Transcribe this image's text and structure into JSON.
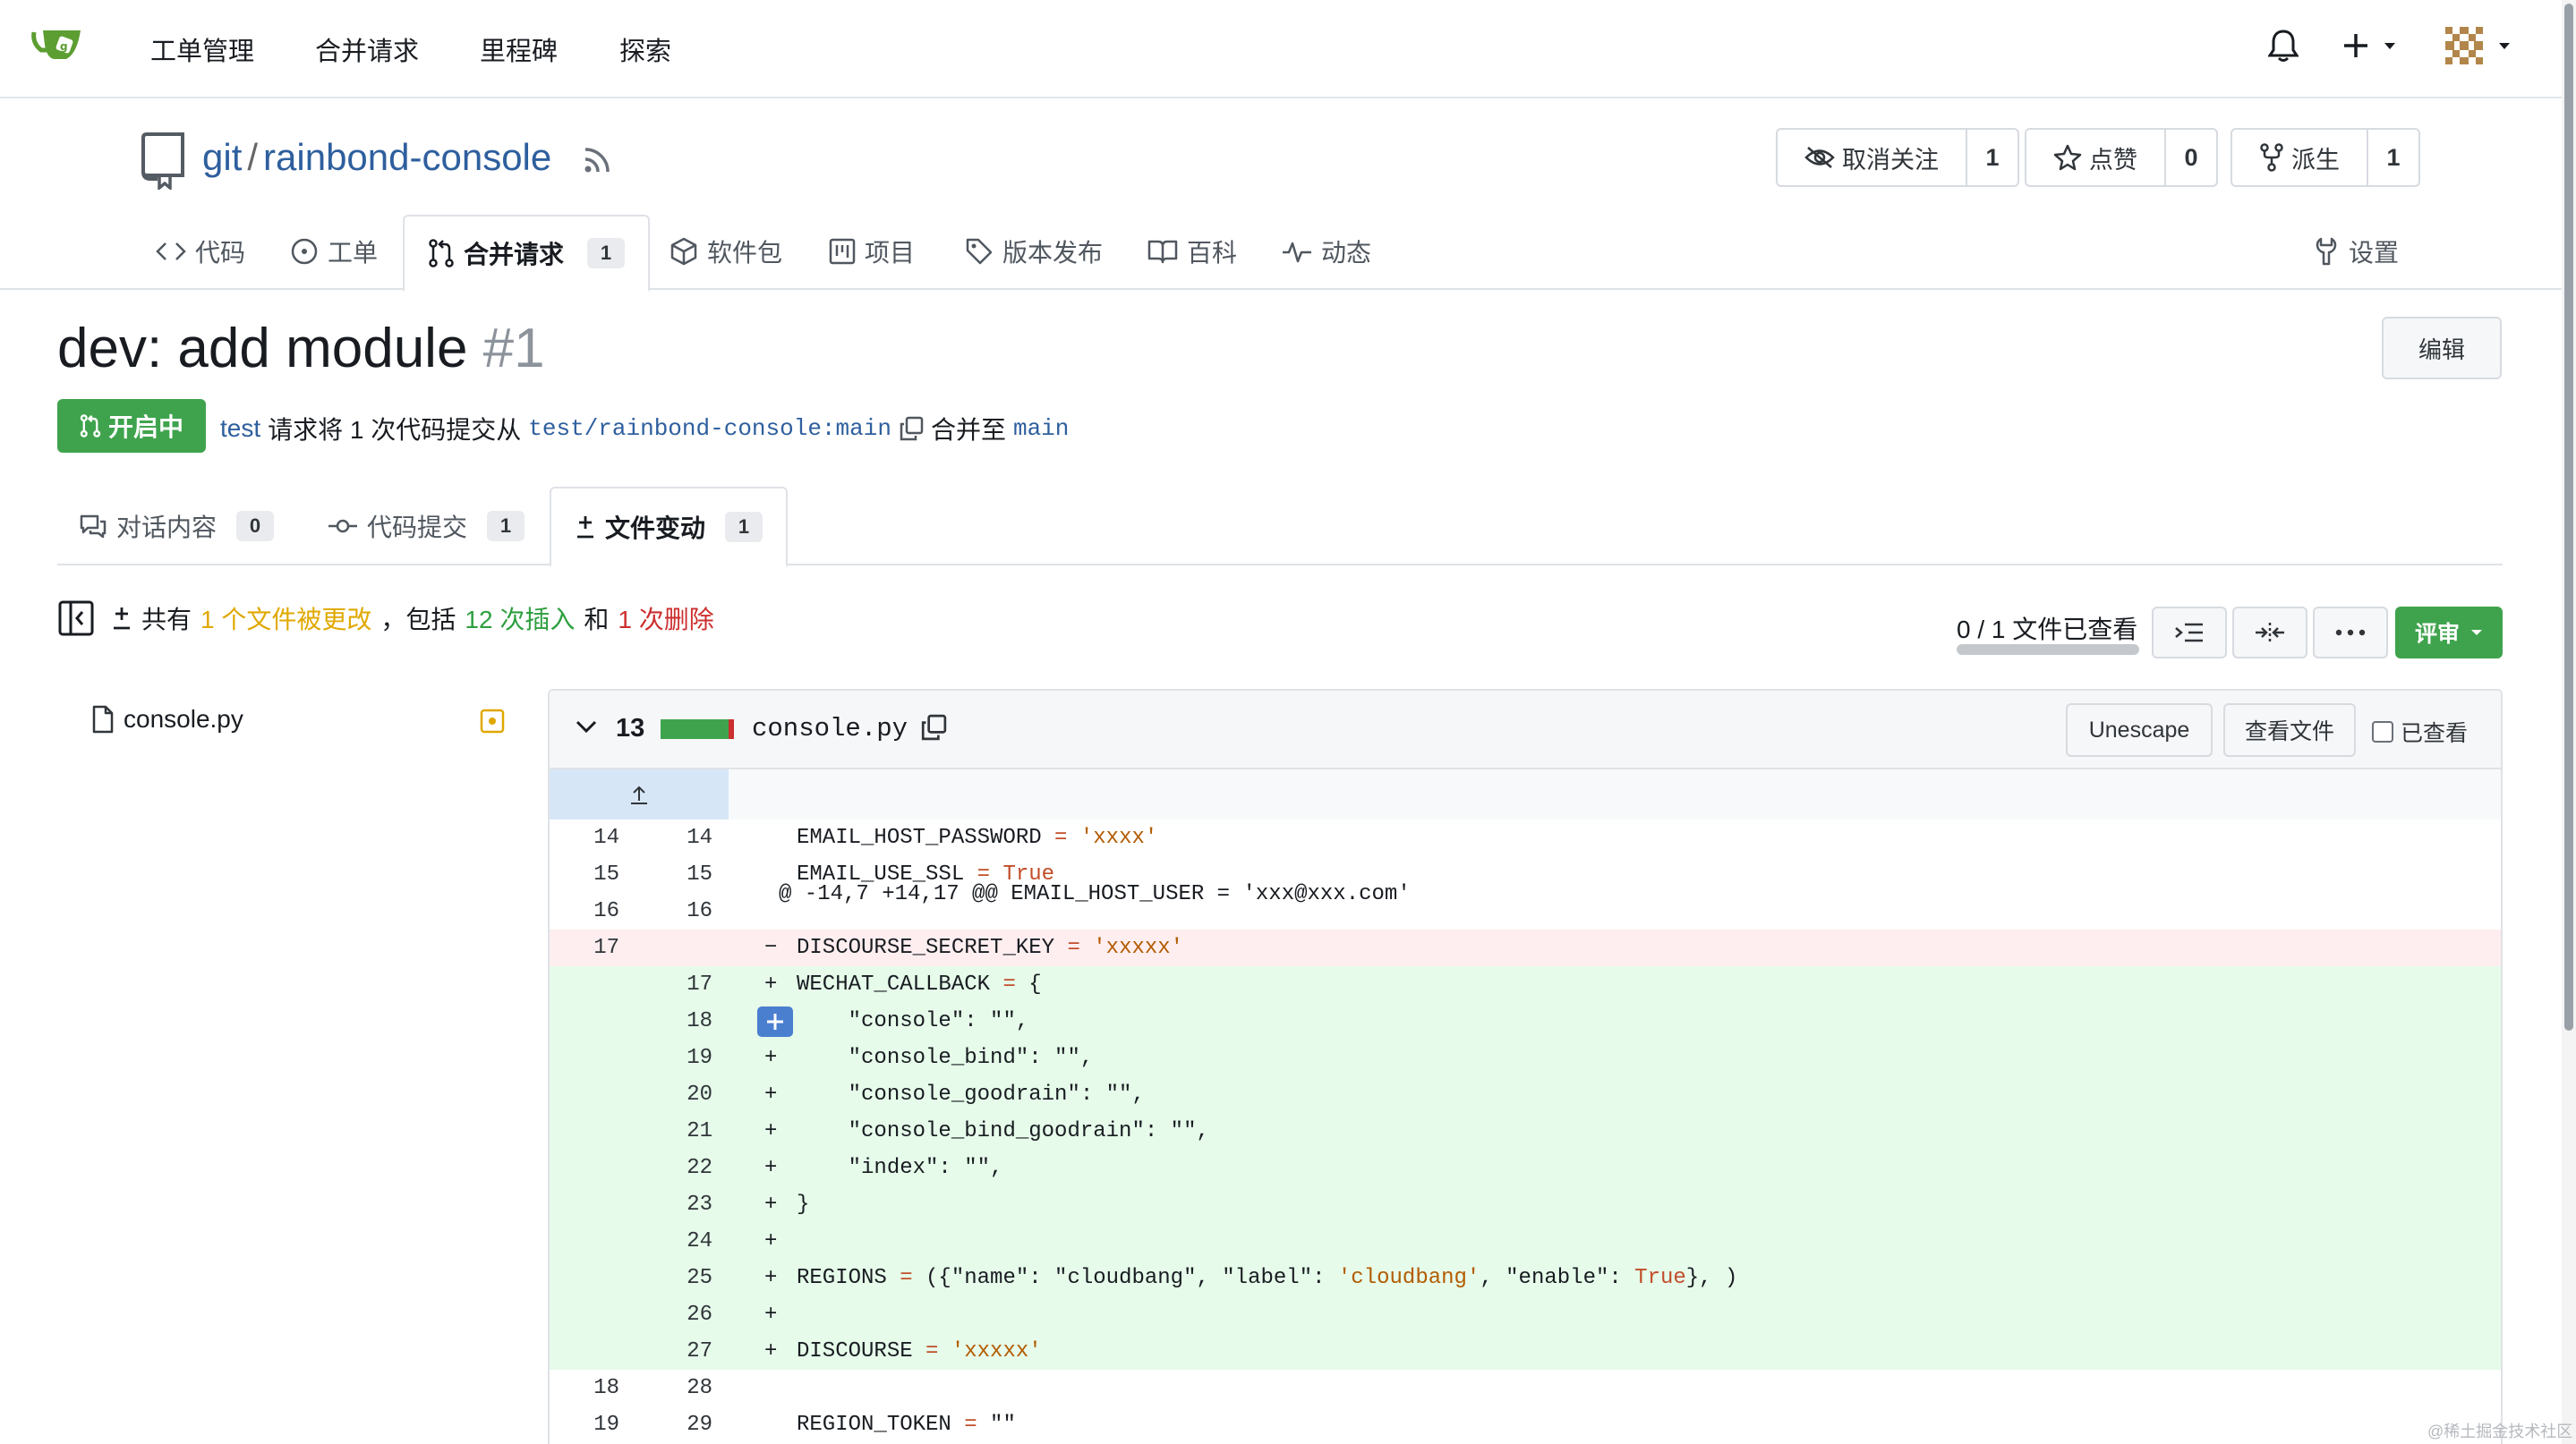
{
  "nav": {
    "items": [
      "工单管理",
      "合并请求",
      "里程碑",
      "探索"
    ]
  },
  "repo": {
    "owner": "git",
    "name": "rainbond-console",
    "unwatch_label": "取消关注",
    "watch_count": "1",
    "star_label": "点赞",
    "star_count": "0",
    "fork_label": "派生",
    "fork_count": "1",
    "tabs": {
      "code": "代码",
      "issues": "工单",
      "pulls": "合并请求",
      "pulls_count": "1",
      "packages": "软件包",
      "projects": "项目",
      "releases": "版本发布",
      "wiki": "百科",
      "activity": "动态",
      "settings": "设置"
    }
  },
  "pr": {
    "title": "dev: add module",
    "number": "#1",
    "edit_label": "编辑",
    "status": "开启中",
    "author": "test",
    "meta_text": "请求将 1 次代码提交从",
    "source_branch": "test/rainbond-console:main",
    "merge_into": "合并至",
    "target_branch": "main",
    "subtabs": {
      "conversation": "对话内容",
      "conversation_count": "0",
      "commits": "代码提交",
      "commits_count": "1",
      "files": "文件变动",
      "files_count": "1"
    }
  },
  "stats": {
    "prefix": "共有",
    "files_changed": "1 个文件被更改",
    "comma": "，包括",
    "additions": "12 次插入",
    "and": "和",
    "deletions": "1 次删除",
    "viewed": "0 / 1 文件已查看",
    "viewed_fraction": 0,
    "review_label": "评审"
  },
  "file_tree": {
    "file": "console.py"
  },
  "diff": {
    "file": "console.py",
    "changes": "13",
    "unescape_label": "Unescape",
    "view_file_label": "查看文件",
    "viewed_label": "已查看",
    "hunk_header": "@ -14,7 +14,17 @@ EMAIL_HOST_USER = 'xxx@xxx.com'",
    "lines": [
      {
        "type": "ctx",
        "old": "14",
        "new": "14",
        "mark": "",
        "code": [
          [
            "EMAIL_HOST_PASSWORD ",
            ""
          ],
          [
            "=",
            "kw"
          ],
          [
            " ",
            ""
          ],
          [
            "'xxxx'",
            "str"
          ]
        ]
      },
      {
        "type": "ctx",
        "old": "15",
        "new": "15",
        "mark": "",
        "code": [
          [
            "EMAIL_USE_SSL ",
            ""
          ],
          [
            "=",
            "kw"
          ],
          [
            " ",
            ""
          ],
          [
            "True",
            "kw"
          ]
        ]
      },
      {
        "type": "ctx",
        "old": "16",
        "new": "16",
        "mark": "",
        "code": []
      },
      {
        "type": "del",
        "old": "17",
        "new": "",
        "mark": "−",
        "code": [
          [
            "DISCOURSE_SECRET_KEY ",
            ""
          ],
          [
            "=",
            "kw"
          ],
          [
            " ",
            ""
          ],
          [
            "'xxxxx'",
            "str"
          ]
        ]
      },
      {
        "type": "add",
        "old": "",
        "new": "17",
        "mark": "+",
        "code": [
          [
            "WECHAT_CALLBACK ",
            ""
          ],
          [
            "=",
            "kw"
          ],
          [
            " {",
            ""
          ]
        ]
      },
      {
        "type": "add",
        "old": "",
        "new": "18",
        "mark": "+",
        "plusbtn": true,
        "code": [
          [
            "    \"console\": \"\",",
            ""
          ]
        ]
      },
      {
        "type": "add",
        "old": "",
        "new": "19",
        "mark": "+",
        "code": [
          [
            "    \"console_bind\": \"\",",
            ""
          ]
        ]
      },
      {
        "type": "add",
        "old": "",
        "new": "20",
        "mark": "+",
        "code": [
          [
            "    \"console_goodrain\": \"\",",
            ""
          ]
        ]
      },
      {
        "type": "add",
        "old": "",
        "new": "21",
        "mark": "+",
        "code": [
          [
            "    \"console_bind_goodrain\": \"\",",
            ""
          ]
        ]
      },
      {
        "type": "add",
        "old": "",
        "new": "22",
        "mark": "+",
        "code": [
          [
            "    \"index\": \"\",",
            ""
          ]
        ]
      },
      {
        "type": "add",
        "old": "",
        "new": "23",
        "mark": "+",
        "code": [
          [
            "}",
            ""
          ]
        ]
      },
      {
        "type": "add",
        "old": "",
        "new": "24",
        "mark": "+",
        "code": []
      },
      {
        "type": "add",
        "old": "",
        "new": "25",
        "mark": "+",
        "code": [
          [
            "REGIONS ",
            ""
          ],
          [
            "=",
            "kw"
          ],
          [
            " ({\"name\": \"cloudbang\", \"label\": ",
            ""
          ],
          [
            "'cloudbang'",
            "str"
          ],
          [
            ", \"enable\": ",
            ""
          ],
          [
            "True",
            "kw"
          ],
          [
            "}, )",
            ""
          ]
        ]
      },
      {
        "type": "add",
        "old": "",
        "new": "26",
        "mark": "+",
        "code": []
      },
      {
        "type": "add",
        "old": "",
        "new": "27",
        "mark": "+",
        "code": [
          [
            "DISCOURSE ",
            ""
          ],
          [
            "=",
            "kw"
          ],
          [
            " ",
            ""
          ],
          [
            "'xxxxx'",
            "str"
          ]
        ]
      },
      {
        "type": "ctx",
        "old": "18",
        "new": "28",
        "mark": "",
        "code": []
      },
      {
        "type": "ctx",
        "old": "19",
        "new": "29",
        "mark": "",
        "code": [
          [
            "REGION_TOKEN ",
            ""
          ],
          [
            "=",
            "kw"
          ],
          [
            " \"\"",
            ""
          ]
        ]
      }
    ]
  },
  "watermark": "@稀土掘金技术社区",
  "colors": {
    "accent_green": "#3fa34d",
    "link_blue": "#2e5f9e",
    "add_bg": "#e6fbea",
    "del_bg": "#ffeef0"
  }
}
